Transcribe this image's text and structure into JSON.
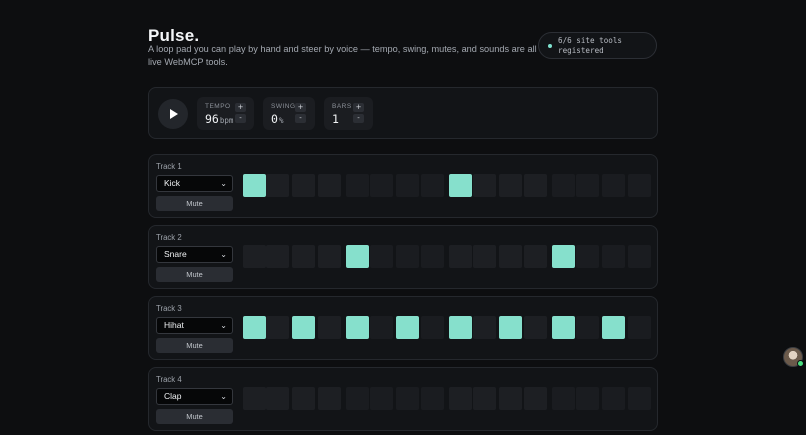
{
  "app": {
    "title": "Pulse.",
    "subtitle": "A loop pad you can play by hand and steer by voice — tempo, swing, mutes, and sounds are all live WebMCP tools."
  },
  "badge": {
    "text": "6/6 site tools registered",
    "dot_color": "#7fe3cf"
  },
  "transport": {
    "play_icon": "play-icon",
    "tempo": {
      "label": "TEMPO",
      "value": "96",
      "unit": "bpm",
      "plus": "+",
      "minus": "-"
    },
    "swing": {
      "label": "SWING",
      "value": "0",
      "unit": "%",
      "plus": "+",
      "minus": "-"
    },
    "bars": {
      "label": "BARS",
      "value": "1",
      "unit": "",
      "plus": "+",
      "minus": "-"
    }
  },
  "tracks": [
    {
      "name": "Track 1",
      "sound": "Kick",
      "mute": "Mute",
      "steps": [
        1,
        0,
        0,
        0,
        0,
        0,
        0,
        0,
        1,
        0,
        0,
        0,
        0,
        0,
        0,
        0
      ]
    },
    {
      "name": "Track 2",
      "sound": "Snare",
      "mute": "Mute",
      "steps": [
        0,
        0,
        0,
        0,
        1,
        0,
        0,
        0,
        0,
        0,
        0,
        0,
        1,
        0,
        0,
        0
      ]
    },
    {
      "name": "Track 3",
      "sound": "Hihat",
      "mute": "Mute",
      "steps": [
        1,
        0,
        1,
        0,
        1,
        0,
        1,
        0,
        1,
        0,
        1,
        0,
        1,
        0,
        1,
        0
      ]
    },
    {
      "name": "Track 4",
      "sound": "Clap",
      "mute": "Mute",
      "steps": [
        0,
        0,
        0,
        0,
        0,
        0,
        0,
        0,
        0,
        0,
        0,
        0,
        0,
        0,
        0,
        0
      ]
    }
  ],
  "colors": {
    "accent": "#86e0cc",
    "background": "#0d0e10",
    "online": "#4ade80"
  }
}
